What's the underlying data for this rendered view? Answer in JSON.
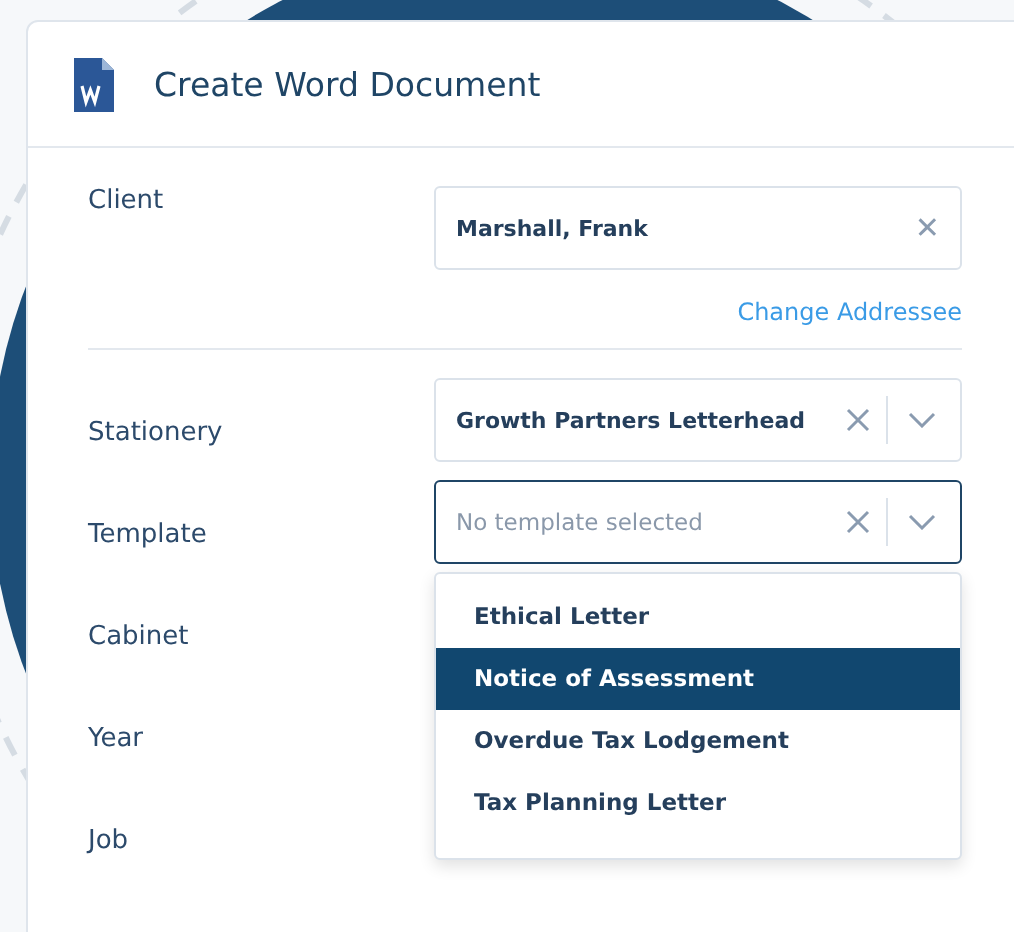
{
  "dialog": {
    "title": "Create Word Document"
  },
  "client": {
    "label": "Client",
    "value": "Marshall, Frank",
    "clear": "✕"
  },
  "change_addressee": "Change Addressee",
  "fields": [
    {
      "label": "Stationery",
      "kind": "select",
      "value": "Growth Partners Letterhead",
      "focused": false
    },
    {
      "label": "Template",
      "kind": "select",
      "placeholder": "No template selected",
      "focused": true
    },
    {
      "label": "Cabinet",
      "kind": "hidden"
    },
    {
      "label": "Year",
      "kind": "hidden"
    },
    {
      "label": "Job",
      "kind": "hidden"
    }
  ],
  "template_menu": {
    "open": true
  },
  "template_options": [
    {
      "label": "Ethical Letter",
      "selected": false
    },
    {
      "label": "Notice of Assessment",
      "selected": true
    },
    {
      "label": "Overdue Tax Lodgement",
      "selected": false
    },
    {
      "label": "Tax Planning Letter",
      "selected": false
    }
  ]
}
